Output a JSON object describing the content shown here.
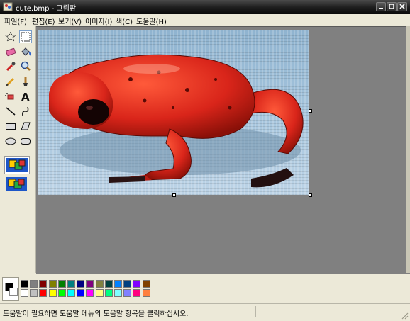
{
  "window": {
    "title": "cute.bmp - 그림판"
  },
  "menu": [
    "파일(F)",
    "편집(E)",
    "보기(V)",
    "이미지(I)",
    "색(C)",
    "도움말(H)"
  ],
  "tools": [
    {
      "name": "free-select-icon",
      "glyph": "☆"
    },
    {
      "name": "rect-select-icon",
      "glyph": "⬚"
    },
    {
      "name": "eraser-icon",
      "glyph": "▬"
    },
    {
      "name": "fill-bucket-icon",
      "glyph": "◆"
    },
    {
      "name": "color-picker-icon",
      "glyph": "╱"
    },
    {
      "name": "magnifier-icon",
      "glyph": "🔍"
    },
    {
      "name": "pencil-icon",
      "glyph": "✎"
    },
    {
      "name": "brush-icon",
      "glyph": "♠"
    },
    {
      "name": "airbrush-icon",
      "glyph": "✸"
    },
    {
      "name": "text-icon",
      "glyph": "A"
    },
    {
      "name": "line-icon",
      "glyph": "╲"
    },
    {
      "name": "curve-icon",
      "glyph": "∫"
    },
    {
      "name": "rectangle-icon",
      "glyph": "▭"
    },
    {
      "name": "polygon-icon",
      "glyph": "⏢"
    },
    {
      "name": "ellipse-icon",
      "glyph": "⬭"
    },
    {
      "name": "rounded-rect-icon",
      "glyph": "▢"
    }
  ],
  "palette": {
    "foreground": "#000000",
    "background": "#ffffff",
    "top_row": [
      "#000000",
      "#808080",
      "#800000",
      "#808000",
      "#008000",
      "#008080",
      "#000080",
      "#800080",
      "#808040",
      "#004040",
      "#0080ff",
      "#004080",
      "#8000ff",
      "#804000"
    ],
    "bottom_row": [
      "#ffffff",
      "#c0c0c0",
      "#ff0000",
      "#ffff00",
      "#00ff00",
      "#00ffff",
      "#0000ff",
      "#ff00ff",
      "#ffff80",
      "#00ff80",
      "#80ffff",
      "#8080ff",
      "#ff0080",
      "#ff8040"
    ]
  },
  "status": {
    "help_text": "도움말이 필요하면 도움말 메뉴의 도움말 항목을 클릭하십시오."
  }
}
